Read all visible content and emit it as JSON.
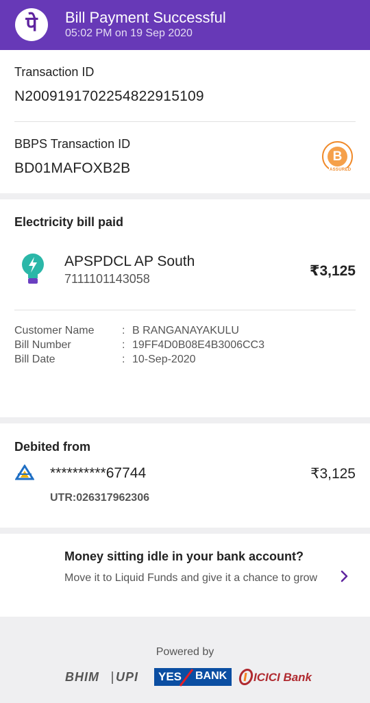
{
  "header": {
    "logo_glyph": "पे",
    "title": "Bill Payment Successful",
    "subtitle": "05:02 PM on 19 Sep 2020",
    "color": "#6739b7"
  },
  "transaction": {
    "id_label": "Transaction ID",
    "id_value": "N2009191702254822915109",
    "bbps_label": "BBPS Transaction ID",
    "bbps_value": "BD01MAFOXB2B",
    "assured_letter": "B",
    "assured_tag": "ASSURED"
  },
  "bill": {
    "section_title": "Electricity bill paid",
    "biller_name": "APSPDCL AP South",
    "biller_account": "7111101143058",
    "amount": "₹3,125",
    "details": [
      {
        "key": "Customer Name",
        "sep": ":",
        "value": "B RANGANAYAKULU"
      },
      {
        "key": "Bill Number",
        "sep": ":",
        "value": "19FF4D0B08E4B3006CC3"
      },
      {
        "key": "Bill Date",
        "sep": ":",
        "value": "10-Sep-2020"
      }
    ]
  },
  "debit": {
    "section_title": "Debited from",
    "account_masked": "**********67744",
    "amount": "₹3,125",
    "utr": "UTR:026317962306"
  },
  "promo": {
    "title": "Money sitting idle in your bank account?",
    "text": "Move it to Liquid Funds and give it a chance to grow"
  },
  "footer": {
    "powered_by": "Powered by",
    "bhim_text": "BHIM",
    "upi_text": "UPI",
    "yes_text": "YES",
    "bank_text": "BANK",
    "icici_text": "ICICI Bank"
  }
}
